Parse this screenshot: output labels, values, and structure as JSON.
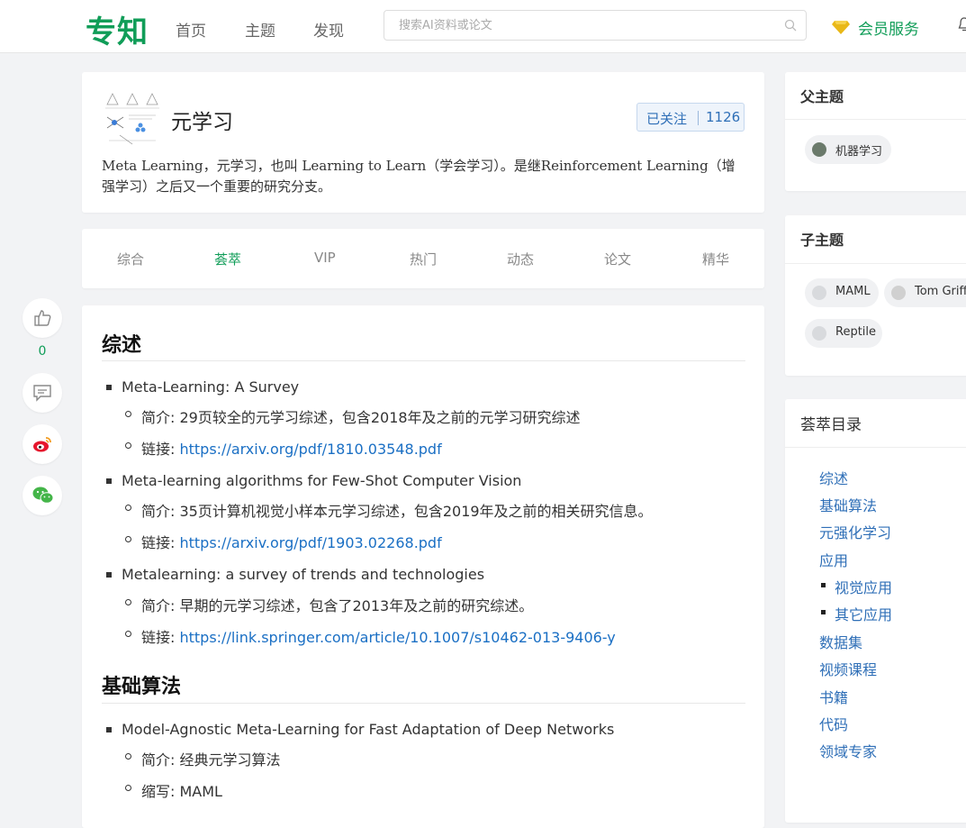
{
  "nav": {
    "logo": "专知",
    "links": [
      "首页",
      "主题",
      "发现"
    ],
    "search_placeholder": "搜索AI资料或论文",
    "member_label": "会员服务"
  },
  "share": {
    "like_count": "0"
  },
  "topic": {
    "title": "元学习",
    "follow_label": "已关注",
    "follow_count": "1126",
    "description": "Meta Learning，元学习，也叫 Learning to Learn（学会学习）。是继Reinforcement Learning（增强学习）之后又一个重要的研究分支。"
  },
  "tabs": [
    "综合",
    "荟萃",
    "VIP",
    "热门",
    "动态",
    "论文",
    "精华"
  ],
  "content": {
    "section1_title": "综述",
    "section2_title": "基础算法",
    "papers": [
      {
        "title": "Meta-Learning: A Survey",
        "intro": "简介: 29页较全的元学习综述，包含2018年及之前的元学习研究综述",
        "link_prefix": "链接: ",
        "link": "https://arxiv.org/pdf/1810.03548.pdf"
      },
      {
        "title": "Meta-learning algorithms for Few-Shot Computer Vision",
        "intro": "简介: 35页计算机视觉小样本元学习综述，包含2019年及之前的相关研究信息。",
        "link_prefix": "链接: ",
        "link": "https://arxiv.org/pdf/1903.02268.pdf"
      },
      {
        "title": "Metalearning: a survey of trends and technologies",
        "intro": "简介: 早期的元学习综述，包含了2013年及之前的研究综述。",
        "link_prefix": "链接: ",
        "link": "https://link.springer.com/article/10.1007/s10462-013-9406-y"
      }
    ],
    "algo": {
      "title": "Model-Agnostic Meta-Learning for Fast Adaptation of Deep Networks",
      "intro": "简介: 经典元学习算法",
      "abbr": "缩写: MAML"
    }
  },
  "sidebar": {
    "parent_head": "父主题",
    "parent_items": [
      "机器学习"
    ],
    "child_head": "子主题",
    "child_items": [
      "MAML",
      "Tom Griffi",
      "Reptile"
    ],
    "toc_head": "荟萃目录",
    "toc": [
      "综述",
      "基础算法",
      "元强化学习",
      "应用",
      "视觉应用",
      "其它应用",
      "数据集",
      "视频课程",
      "书籍",
      "代码",
      "领域专家"
    ]
  },
  "colors": {
    "brand": "#109d58",
    "link": "#1a6fc4",
    "toc_link": "#2f6fb7"
  }
}
